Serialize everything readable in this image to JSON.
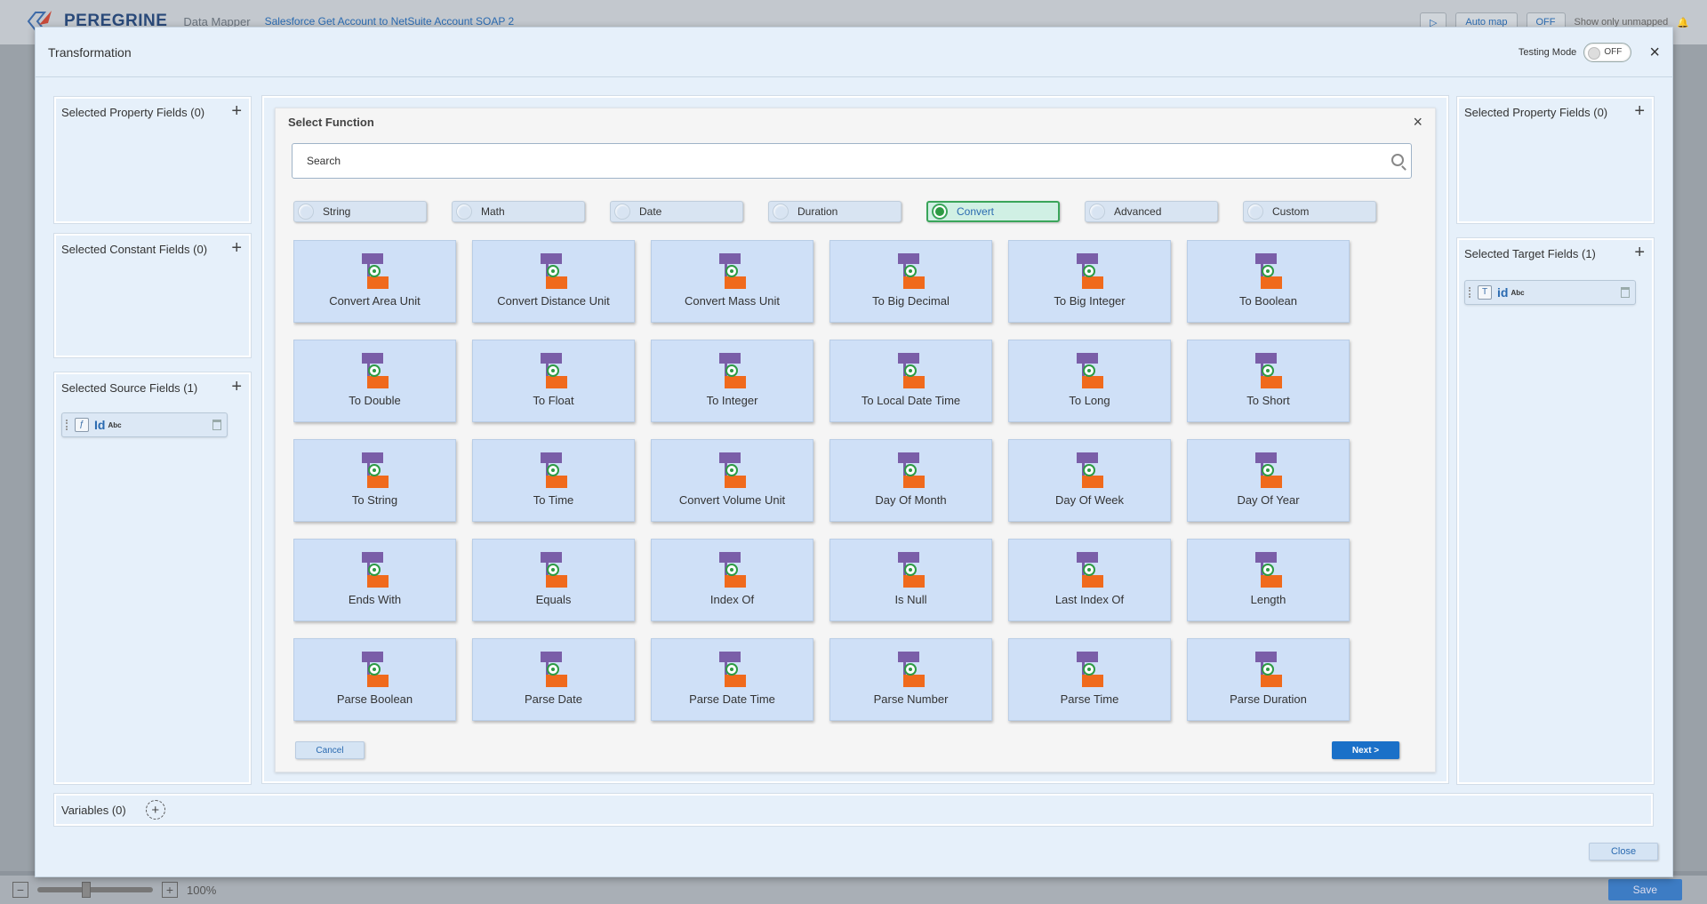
{
  "background": {
    "brand_name": "PEREGRINE",
    "brand_sub": "Data Mapper",
    "flow_name": "Salesforce Get Account to NetSuite Account SOAP 2",
    "auto_map": "Auto map",
    "unmapped_toggle": "OFF",
    "show_unmapped": "Show only unmapped",
    "zoom_level": "100%",
    "save_label": "Save"
  },
  "modal": {
    "title": "Transformation",
    "testing_mode_label": "Testing Mode",
    "testing_mode_value": "OFF"
  },
  "left": {
    "property_title": "Selected Property Fields (0)",
    "constant_title": "Selected Constant Fields (0)",
    "source_title": "Selected Source Fields (1)",
    "source_fields": [
      {
        "name": "Id",
        "type": "Abc"
      }
    ]
  },
  "right": {
    "property_title": "Selected Property Fields (0)",
    "target_title": "Selected Target Fields (1)",
    "target_fields": [
      {
        "name": "id",
        "type": "Abc"
      }
    ]
  },
  "select_function": {
    "title": "Select Function",
    "search_placeholder": "Search",
    "categories": [
      "String",
      "Math",
      "Date",
      "Duration",
      "Convert",
      "Advanced",
      "Custom"
    ],
    "active_category": "Convert",
    "functions": [
      "Convert Area Unit",
      "Convert Distance Unit",
      "Convert Mass Unit",
      "To Big Decimal",
      "To Big Integer",
      "To Boolean",
      "To Double",
      "To Float",
      "To Integer",
      "To Local Date Time",
      "To Long",
      "To Short",
      "To String",
      "To Time",
      "Convert Volume Unit",
      "Day Of Month",
      "Day Of Week",
      "Day Of Year",
      "Ends With",
      "Equals",
      "Index Of",
      "Is Null",
      "Last Index Of",
      "Length",
      "Parse Boolean",
      "Parse Date",
      "Parse Date Time",
      "Parse Number",
      "Parse Time",
      "Parse Duration"
    ],
    "cancel_label": "Cancel",
    "next_label": "Next >"
  },
  "variables": {
    "title": "Variables (0)"
  },
  "close_label": "Close",
  "colors": {
    "accent": "#1a70c8",
    "active_category": "#2d9a44",
    "icon_top": "#7a5ea8",
    "icon_bottom": "#f06a1c"
  }
}
